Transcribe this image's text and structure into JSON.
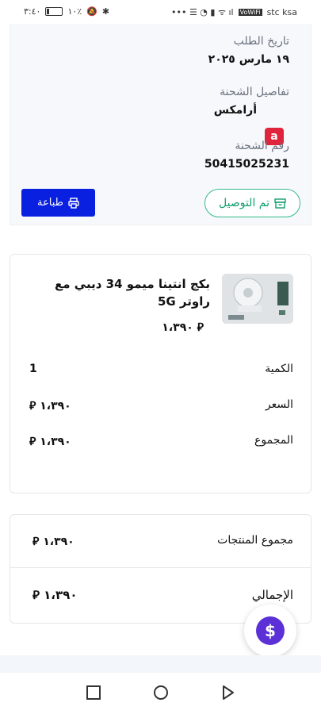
{
  "status_bar": {
    "time": "٣:٤٠",
    "battery": "١٠٪",
    "carrier": "stc ksa",
    "volte": "VoWiFi"
  },
  "order": {
    "date_label": "تاريخ الطلب",
    "date_value": "١٩ مارس ٢٠٢٥",
    "shipment_label": "تفاصيل الشحنة",
    "carrier_name": "أرامكس",
    "carrier_logo_letter": "a",
    "tracking_label": "رقم الشحنة",
    "tracking_number": "50415025231",
    "print_label": "طباعة",
    "delivered_label": "تم التوصيل"
  },
  "product": {
    "title": "بكج انتينا ميمو 34 ديبي مع راوتر 5G",
    "price": "١،٣٩٠",
    "quantity_label": "الكمية",
    "quantity_value": "1",
    "price_label": "السعر",
    "price_value": "١،٣٩٠",
    "total_label": "المجموع",
    "total_value": "١،٣٩٠"
  },
  "summary": {
    "subtotal_label": "مجموع المنتجات",
    "subtotal_value": "١،٣٩٠",
    "grand_total_label": "الإجمالي",
    "grand_total_value": "١،٣٩٠"
  },
  "currency_symbol": "⃁",
  "colors": {
    "primary_button": "#0a20e0",
    "delivered_green": "#34b88a",
    "aramex_red": "#e0243b",
    "fab_purple": "#5b30d6"
  }
}
